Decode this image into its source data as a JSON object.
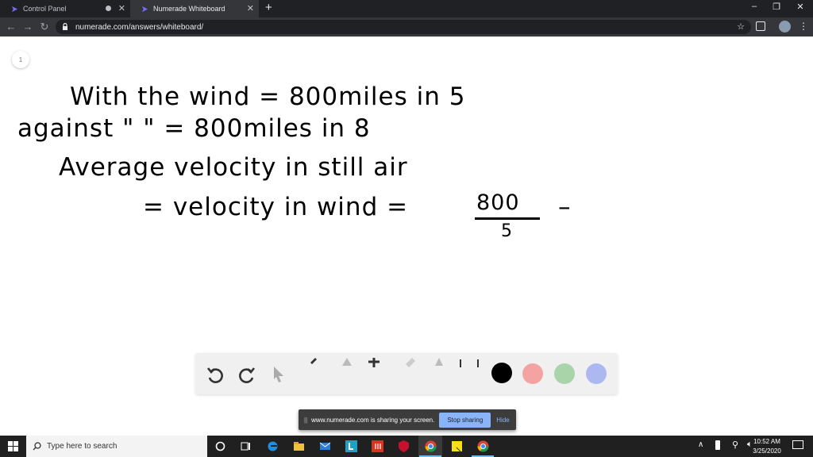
{
  "browser": {
    "tabs": [
      {
        "title": "Control Panel",
        "active": false
      },
      {
        "title": "Numerade Whiteboard",
        "active": true
      }
    ],
    "url": "numerade.com/answers/whiteboard/"
  },
  "whiteboard": {
    "page_number": "1",
    "lines": [
      "With the wind = 800miles in 5",
      "against  \"   \" = 800miles in 8",
      "Average velocity in still air",
      "= velocity in wind =",
      "800",
      "5",
      "–"
    ]
  },
  "drawing_toolbar": {
    "tools": [
      "undo-icon",
      "redo-icon",
      "pointer-icon",
      "pen-icon",
      "shapes-icon",
      "add-icon",
      "eraser-icon",
      "highlighter-icon",
      "image-icon"
    ],
    "colors": [
      "#000000",
      "#f4a3a3",
      "#a9d3a9",
      "#aeb8f0"
    ]
  },
  "share_bar": {
    "message": "www.numerade.com is sharing your screen.",
    "stop_label": "Stop sharing",
    "hide_label": "Hide"
  },
  "taskbar": {
    "search_placeholder": "Type here to search",
    "time": "10:52 AM",
    "date": "3/25/2020"
  }
}
